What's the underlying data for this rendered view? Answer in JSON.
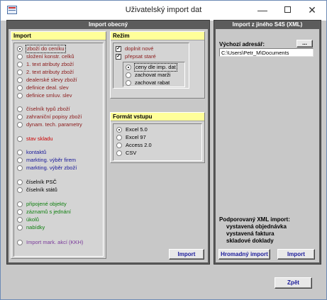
{
  "window": {
    "title": "Uživatelský import dat"
  },
  "left_panel": {
    "header": "Import obecný",
    "import_group": {
      "title": "Import",
      "options": [
        {
          "label": "zboží do ceníku",
          "color": "maroon",
          "selected": true
        },
        {
          "label": "složení konstr. celků",
          "color": "maroon",
          "selected": false
        },
        {
          "label": "1. text atributy zboží",
          "color": "maroon",
          "selected": false
        },
        {
          "label": "2. text atributy zboží",
          "color": "maroon",
          "selected": false
        },
        {
          "label": "dealerské slevy zboží",
          "color": "maroon",
          "selected": false
        },
        {
          "label": "definice deal. slev",
          "color": "maroon",
          "selected": false
        },
        {
          "label": "definice smluv. slev",
          "color": "maroon",
          "selected": false
        },
        {
          "label": "číselník typů zboží",
          "color": "maroon",
          "selected": false
        },
        {
          "label": "zahraniční popisy zboží",
          "color": "maroon",
          "selected": false
        },
        {
          "label": "dynam. tech. parametry",
          "color": "maroon",
          "selected": false
        },
        {
          "label": "stav skladu",
          "color": "red",
          "selected": false
        },
        {
          "label": "kontaktů",
          "color": "navy",
          "selected": false
        },
        {
          "label": "markting. výběr firem",
          "color": "navy",
          "selected": false
        },
        {
          "label": "markting. výběr zboží",
          "color": "navy",
          "selected": false
        },
        {
          "label": "číselník PSČ",
          "color": "black",
          "selected": false
        },
        {
          "label": "číselník států",
          "color": "black",
          "selected": false
        },
        {
          "label": "připojené objekty",
          "color": "green",
          "selected": false
        },
        {
          "label": "záznamů s jednání",
          "color": "green",
          "selected": false
        },
        {
          "label": "úkolů",
          "color": "green",
          "selected": false
        },
        {
          "label": "nabídky",
          "color": "green",
          "selected": false
        },
        {
          "label": "Import mark. akcí (KKH)",
          "color": "purple",
          "selected": false
        }
      ]
    },
    "mode_group": {
      "title": "Režim",
      "checkboxes": [
        {
          "label": "doplnit nové",
          "checked": true
        },
        {
          "label": "přepsat staré",
          "checked": true
        }
      ],
      "radios": [
        {
          "label": "ceny dle imp. dat",
          "selected": true
        },
        {
          "label": "zachovat marži",
          "selected": false
        },
        {
          "label": "zachovat rabat",
          "selected": false
        }
      ]
    },
    "format_group": {
      "title": "Formát vstupu",
      "options": [
        {
          "label": "Excel 5.0",
          "selected": true
        },
        {
          "label": "Excel 97",
          "selected": false
        },
        {
          "label": "Access 2.0",
          "selected": false
        },
        {
          "label": "CSV",
          "selected": false
        }
      ]
    },
    "import_button": "Import"
  },
  "right_panel": {
    "header": "Import z jiného S4S (XML)",
    "source_dir_label": "Výchozí adresář:",
    "browse_button": "...",
    "source_dir_value": "C:\\Users\\Petr_M\\Documents",
    "supported_title": "Podporovaný XML import:",
    "supported_items": [
      "vystavená objednávka",
      "vystavená faktura",
      "skladové doklady"
    ],
    "bulk_import_button": "Hromadný import",
    "import_button": "Import"
  },
  "footer": {
    "back_button": "Zpět"
  },
  "colors": {
    "maroon": "#8b1a1a",
    "red": "#cc0000",
    "navy": "#1a1a9a",
    "green": "#108010",
    "purple": "#7a3a9a",
    "black": "#000000",
    "group_title_bg": "#ffff99",
    "panel_header_bg": "#5c5c5c"
  }
}
